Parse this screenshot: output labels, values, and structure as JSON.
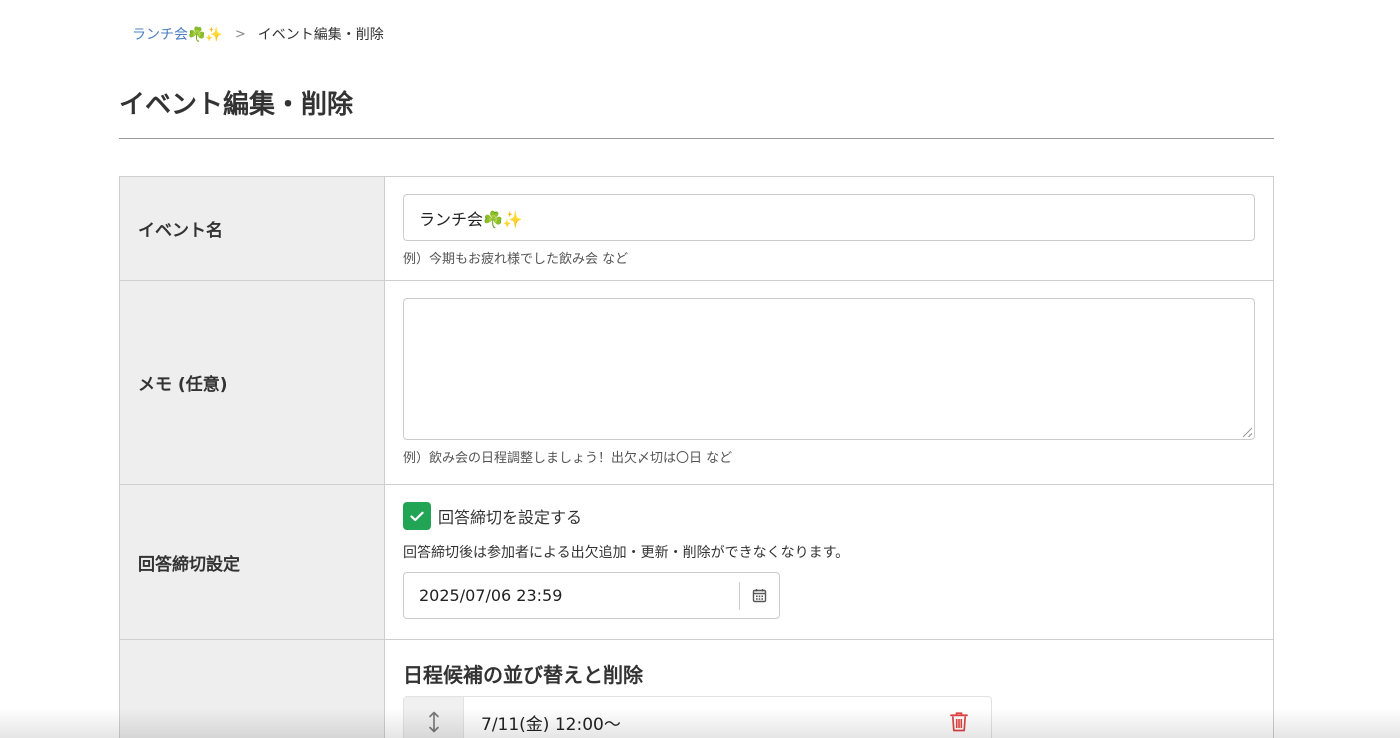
{
  "breadcrumb": {
    "parent": "ランチ会☘️✨",
    "separator": ">",
    "current": "イベント編集・削除"
  },
  "page": {
    "title": "イベント編集・削除"
  },
  "form": {
    "event_name": {
      "label": "イベント名",
      "value": "ランチ会☘️✨",
      "hint": "例）今期もお疲れ様でした飲み会 など"
    },
    "memo": {
      "label": "メモ (任意)",
      "value": "",
      "hint": "例）飲み会の日程調整しましょう！出欠〆切は〇日 など"
    },
    "deadline": {
      "label": "回答締切設定",
      "checkbox_label": "回答締切を設定する",
      "checked": true,
      "note": "回答締切後は参加者による出欠追加・更新・削除ができなくなります。",
      "datetime": "2025/07/06 23:59",
      "icon": "calendar-icon"
    },
    "schedule": {
      "label": "",
      "heading": "日程候補の並び替えと削除",
      "candidates": [
        {
          "label": "7/11(金) 12:00〜"
        }
      ]
    }
  },
  "colors": {
    "accent_green": "#21a554",
    "link_blue": "#4a7fc1",
    "danger_red": "#e04343",
    "label_bg": "#eeeeee"
  }
}
